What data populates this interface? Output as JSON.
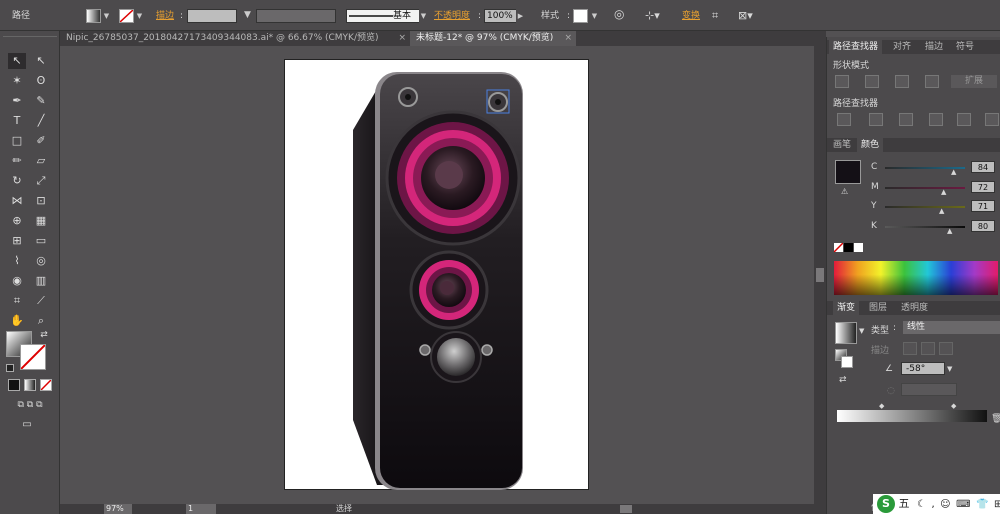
{
  "control_bar": {
    "selection_type": "路径",
    "stroke_label": "描边",
    "stroke_style": "基本",
    "opacity_label": "不透明度",
    "opacity_value": "100%",
    "style_label": "样式",
    "transform_label": "变换"
  },
  "document_tabs": [
    {
      "title": "Nipic_26785037_20180427173409344083.ai* @ 66.67% (CMYK/预览)",
      "active": false
    },
    {
      "title": "未标题-12* @ 97% (CMYK/预览)",
      "active": true
    }
  ],
  "panels": {
    "pathfinder_tabs": [
      "路径查找器",
      "对齐",
      "描边",
      "符号"
    ],
    "shape_modes_label": "形状模式",
    "expand_label": "扩展",
    "pathfinders_label": "路径查找器",
    "color_tabs": [
      "画笔",
      "颜色"
    ],
    "cmyk": [
      {
        "channel": "C",
        "value": "84"
      },
      {
        "channel": "M",
        "value": "72"
      },
      {
        "channel": "Y",
        "value": "71"
      },
      {
        "channel": "K",
        "value": "80"
      }
    ],
    "gradient_tabs": [
      "渐变",
      "图层",
      "透明度"
    ],
    "gradient_type_label": "类型",
    "gradient_type_value": "线性",
    "gradient_stroke_label": "描边",
    "gradient_angle": "-58°",
    "location_label": "位"
  },
  "status_bar": {
    "zoom": "97%",
    "page": "1",
    "tool_name": "选择"
  },
  "watermark": {
    "logo": "S",
    "text": "五"
  },
  "colors": {
    "fill_swatch": "#141016",
    "speaker_accent": "#d4267a",
    "speaker_body": "#1a161a"
  }
}
